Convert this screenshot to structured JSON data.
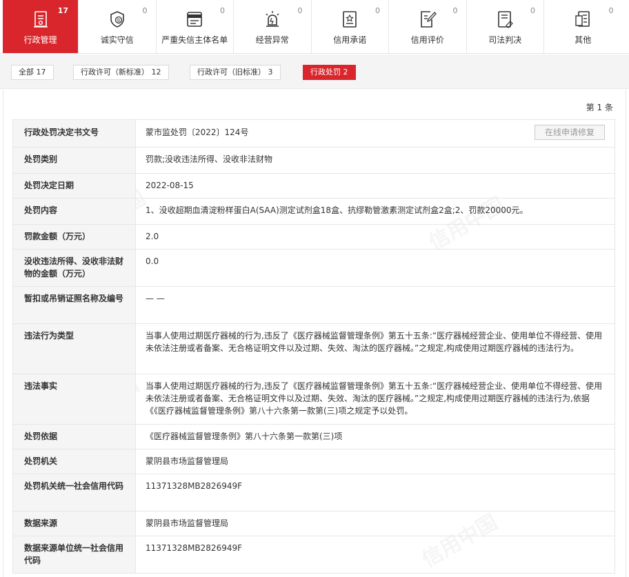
{
  "tabs": [
    {
      "label": "行政管理",
      "count": "17",
      "icon": "admin-doc-icon",
      "active": true
    },
    {
      "label": "诚实守信",
      "count": "0",
      "icon": "shield-icon",
      "active": false
    },
    {
      "label": "严重失信主体名单",
      "count": "0",
      "icon": "blacklist-icon",
      "active": false
    },
    {
      "label": "经营异常",
      "count": "0",
      "icon": "alarm-light-icon",
      "active": false
    },
    {
      "label": "信用承诺",
      "count": "0",
      "icon": "promise-doc-icon",
      "active": false
    },
    {
      "label": "信用评价",
      "count": "0",
      "icon": "evaluation-icon",
      "active": false
    },
    {
      "label": "司法判决",
      "count": "0",
      "icon": "judgement-icon",
      "active": false
    },
    {
      "label": "其他",
      "count": "0",
      "icon": "other-doc-icon",
      "active": false
    }
  ],
  "filters": [
    {
      "label": "全部  17",
      "active": false
    },
    {
      "label": "行政许可（新标准）  12",
      "active": false
    },
    {
      "label": "行政许可（旧标准）  3",
      "active": false
    },
    {
      "label": "行政处罚  2",
      "active": true
    }
  ],
  "total": "第 1 条",
  "repair_button": "在线申请修复",
  "watermark": "信用中国",
  "rows": [
    {
      "key": "行政处罚决定书文号",
      "value": "蒙市监处罚〔2022〕124号"
    },
    {
      "key": "处罚类别",
      "value": "罚款;没收违法所得、没收非法财物"
    },
    {
      "key": "处罚决定日期",
      "value": "2022-08-15"
    },
    {
      "key": "处罚内容",
      "value": "1、没收超期血清淀粉样蛋白A(SAA)测定试剂盒18盒、抗缪勒管激素测定试剂盒2盒;2、罚款20000元。"
    },
    {
      "key": "罚款金额（万元）",
      "value": "2.0"
    },
    {
      "key": "没收违法所得、没收非法财物的金额（万元）",
      "value": "0.0"
    },
    {
      "key": "暂扣或吊销证照名称及编号",
      "value": "— —"
    },
    {
      "key": "违法行为类型",
      "value": "当事人使用过期医疗器械的行为,违反了《医疗器械监督管理条例》第五十五条:“医疗器械经营企业、使用单位不得经营、使用未依法注册或者备案、无合格证明文件以及过期、失效、淘汰的医疗器械。”之规定,构成使用过期医疗器械的违法行为。"
    },
    {
      "key": "违法事实",
      "value": "当事人使用过期医疗器械的行为,违反了《医疗器械监督管理条例》第五十五条:“医疗器械经营企业、使用单位不得经营、使用未依法注册或者备案、无合格证明文件以及过期、失效、淘汰的医疗器械。”之规定,构成使用过期医疗器械的违法行为,依据《《医疗器械监督管理条例》第八十六条第一款第(三)项之规定予以处罚。"
    },
    {
      "key": "处罚依据",
      "value": "《医疗器械监督管理条例》第八十六条第一款第(三)项"
    },
    {
      "key": "处罚机关",
      "value": "蒙阴县市场监督管理局"
    },
    {
      "key": "处罚机关统一社会信用代码",
      "value": "11371328MB2826949F"
    },
    {
      "key": "数据来源",
      "value": "蒙阴县市场监督管理局"
    },
    {
      "key": "数据来源单位统一社会信用代码",
      "value": "11371328MB2826949F"
    }
  ],
  "colors": {
    "accent": "#d9262c",
    "key_bg": "#f5f5f5",
    "border": "#e6e6e6"
  }
}
